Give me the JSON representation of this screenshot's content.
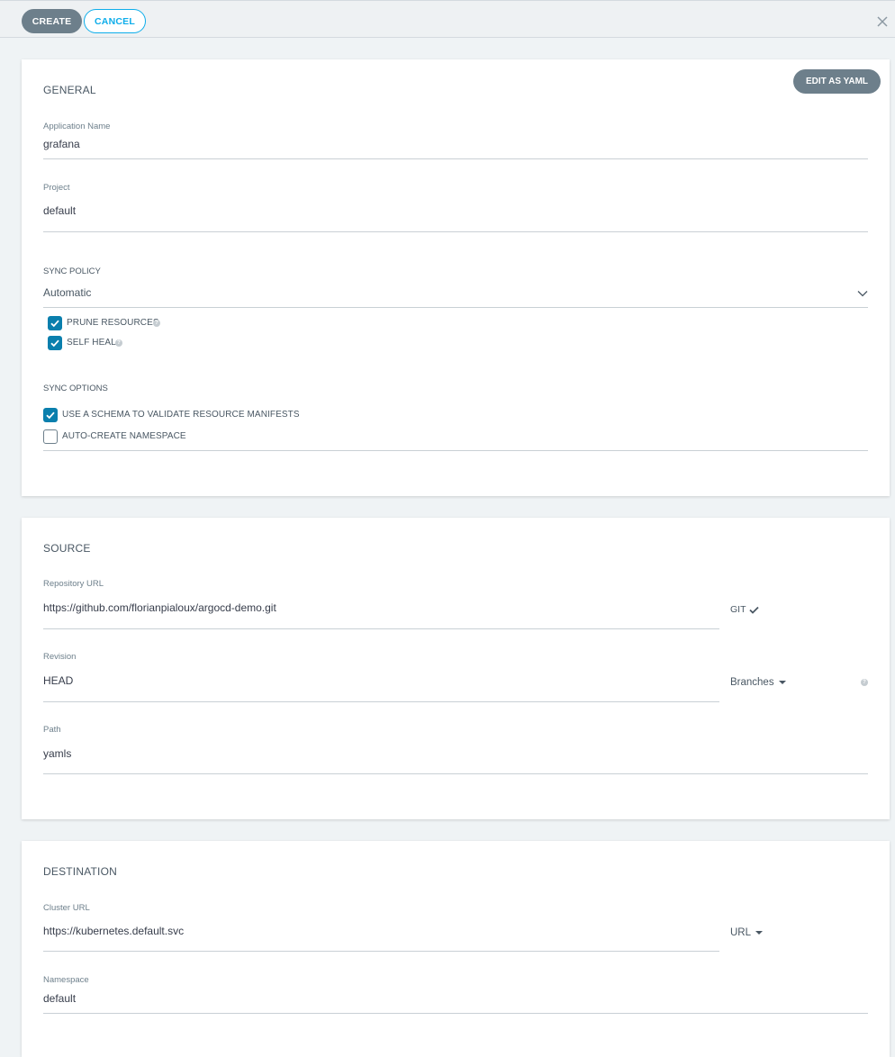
{
  "toolbar": {
    "create_label": "CREATE",
    "cancel_label": "CANCEL",
    "close_icon": "close-icon"
  },
  "general": {
    "title": "GENERAL",
    "edit_yaml_label": "EDIT AS YAML",
    "app_name_label": "Application Name",
    "app_name_value": "grafana",
    "project_label": "Project",
    "project_value": "default",
    "sync_policy_label": "SYNC POLICY",
    "sync_policy_value": "Automatic",
    "prune_label": "PRUNE RESOURCES",
    "prune_checked": true,
    "self_heal_label": "SELF HEAL",
    "self_heal_checked": true,
    "sync_options_label": "SYNC OPTIONS",
    "schema_label": "USE A SCHEMA TO VALIDATE RESOURCE MANIFESTS",
    "schema_checked": true,
    "auto_ns_label": "AUTO-CREATE NAMESPACE",
    "auto_ns_checked": false
  },
  "source": {
    "title": "SOURCE",
    "repo_label": "Repository URL",
    "repo_value": "https://github.com/florianpialoux/argocd-demo.git",
    "repo_type": "GIT",
    "revision_label": "Revision",
    "revision_value": "HEAD",
    "revision_mode": "Branches",
    "path_label": "Path",
    "path_value": "yamls"
  },
  "destination": {
    "title": "DESTINATION",
    "cluster_label": "Cluster URL",
    "cluster_value": "https://kubernetes.default.svc",
    "cluster_mode": "URL",
    "namespace_label": "Namespace",
    "namespace_value": "default"
  },
  "colors": {
    "accent": "#0dadea",
    "checkbox": "#0a7fad",
    "button_gray": "#6d7f8b"
  }
}
